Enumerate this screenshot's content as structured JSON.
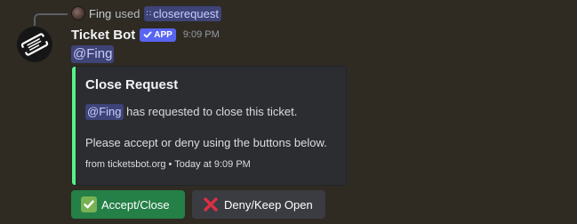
{
  "reply": {
    "user": "Fing",
    "verb": "used",
    "command": "closerequest"
  },
  "message": {
    "author": "Ticket Bot",
    "badge": "APP",
    "timestamp": "9:09 PM",
    "mention": "@Fing"
  },
  "embed": {
    "accent_color": "#57f287",
    "title": "Close Request",
    "mention": "@Fing",
    "line1_rest": " has requested to close this ticket.",
    "line2": "Please accept or deny using the buttons below.",
    "footer": "from ticketsbot.org • Today at 9:09 PM"
  },
  "buttons": {
    "accept_label": "Accept/Close",
    "deny_label": "Deny/Keep Open",
    "accept_icon": "check-mark-emoji-icon",
    "deny_icon": "cross-mark-emoji-icon"
  }
}
